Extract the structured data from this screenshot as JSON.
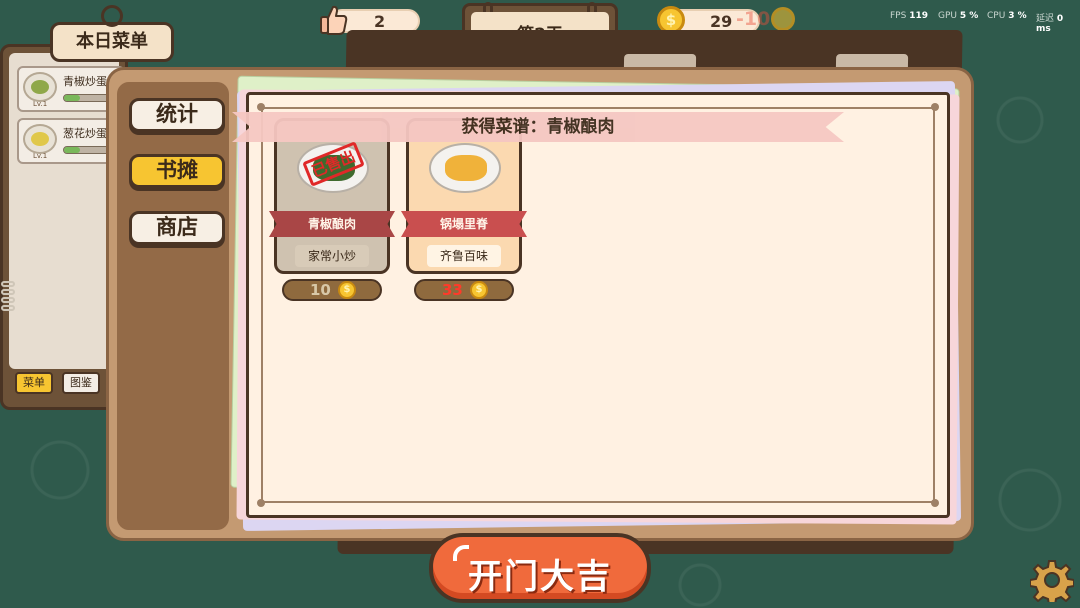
{
  "hud": {
    "likes": "2",
    "day_label": "第2天",
    "coins": "29",
    "coin_delta": "-10",
    "fps_label": "FPS",
    "fps_value": "119",
    "gpu_label": "GPU",
    "gpu_value": "5 %",
    "cpu_label": "CPU",
    "cpu_value": "3 %",
    "latency_label": "延迟",
    "latency_value": "0 ms"
  },
  "menu_panel": {
    "title": "本日菜单",
    "items": [
      {
        "name": "青椒炒蛋",
        "level": "Lv.1",
        "progress": 0.28
      },
      {
        "name": "葱花炒蛋",
        "level": "Lv.1",
        "progress": 0.28
      }
    ],
    "tabs": [
      "菜单",
      "图鉴"
    ]
  },
  "sidebar": {
    "buttons": [
      "统计",
      "书摊",
      "商店"
    ],
    "active": "书摊"
  },
  "banner": {
    "text": "获得菜谱：青椒酿肉"
  },
  "recipes": [
    {
      "name": "青椒酿肉",
      "category": "家常小炒",
      "price": "10",
      "sold_out": true,
      "stamp": "已售出",
      "price_color": "#d8c8a8"
    },
    {
      "name": "锅塌里脊",
      "category": "齐鲁百味",
      "price": "33",
      "sold_out": false,
      "stamp": "",
      "price_color": "#ff3a2a"
    }
  ],
  "coin_symbol": "$",
  "open_button": {
    "label": "开门大吉"
  },
  "icons": {
    "likes": "thumbs-up-icon",
    "coins": "gold-coin-icon",
    "settings": "gear-icon"
  },
  "colors": {
    "accent": "#f7c531",
    "button": "#f06a3c",
    "ribbon": "#c94f4f",
    "wood": "#4a3424"
  }
}
